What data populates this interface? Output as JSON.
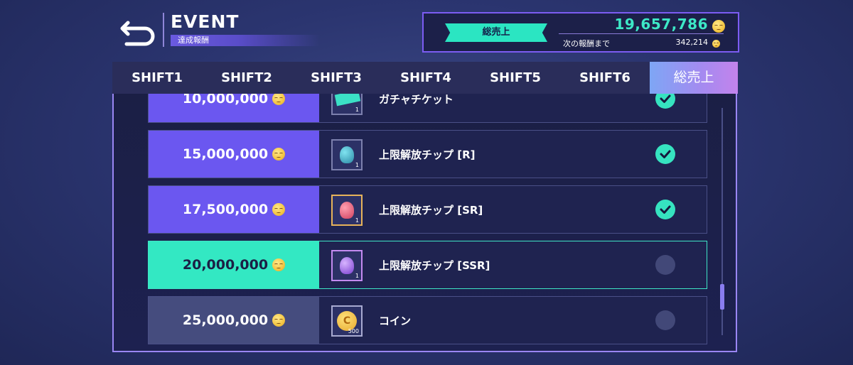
{
  "header": {
    "title": "EVENT",
    "subtitle": "達成報酬"
  },
  "sales": {
    "label": "総売上",
    "total": "19,657,786",
    "next_label": "次の報酬まで",
    "next_value": "342,214"
  },
  "tabs": [
    {
      "label": "SHIFT1",
      "active": false
    },
    {
      "label": "SHIFT2",
      "active": false
    },
    {
      "label": "SHIFT3",
      "active": false
    },
    {
      "label": "SHIFT4",
      "active": false
    },
    {
      "label": "SHIFT5",
      "active": false
    },
    {
      "label": "SHIFT6",
      "active": false
    },
    {
      "label": "総売上",
      "active": true
    }
  ],
  "rewards": [
    {
      "amount": "10,000,000",
      "name": "ガチャチケット",
      "qty": "1",
      "status": "claimed",
      "icon": "ticket-icon"
    },
    {
      "amount": "15,000,000",
      "name": "上限解放チップ [R]",
      "qty": "1",
      "status": "claimed",
      "icon": "chip-r-icon"
    },
    {
      "amount": "17,500,000",
      "name": "上限解放チップ [SR]",
      "qty": "1",
      "status": "claimed",
      "icon": "chip-sr-icon"
    },
    {
      "amount": "20,000,000",
      "name": "上限解放チップ [SSR]",
      "qty": "1",
      "status": "next",
      "icon": "chip-ssr-icon"
    },
    {
      "amount": "25,000,000",
      "name": "コイン",
      "qty": "500",
      "status": "locked",
      "icon": "coin-icon"
    }
  ],
  "colors": {
    "accent_teal": "#33e8c3",
    "accent_purple": "#6b57f0",
    "locked_slate": "#454c7e",
    "frame_border": "#9a86f3"
  },
  "coin_glyph": "C"
}
